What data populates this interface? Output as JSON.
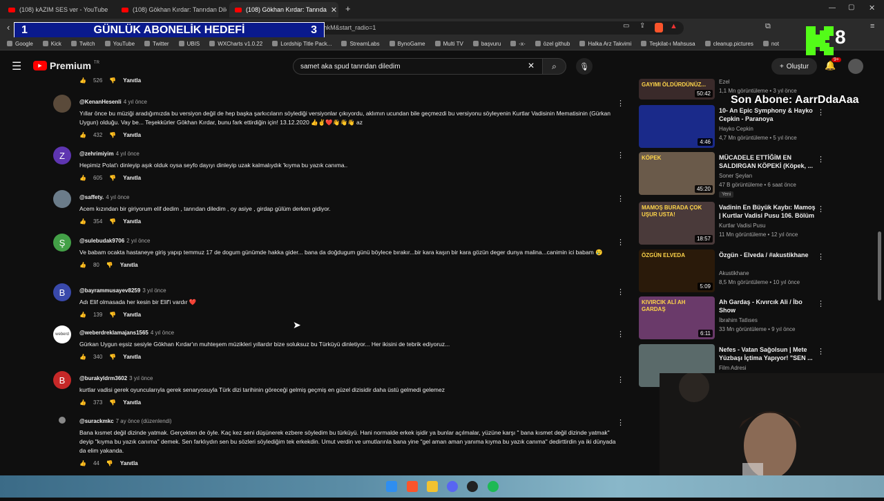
{
  "browser": {
    "tabs": [
      {
        "title": "(108) kAZIM SES ver - YouTube",
        "active": false
      },
      {
        "title": "(108) Gökhan Kırdar: Tanrıdan Diledin",
        "active": false
      },
      {
        "title": "(108) Gökhan Kırdar: Tanrıda",
        "active": true
      }
    ],
    "url": "vatch?v=NjaucnidhkM&list=RDNjaucnidhkM&start_radio=1",
    "bookmarks": [
      "Google",
      "Kick",
      "Twitch",
      "YouTube",
      "Twitter",
      "UBIS",
      "WXCharts v1.0.22",
      "Lordship Title Pack...",
      "StreamLabs",
      "BynoGame",
      "Multi TV",
      "başvuru",
      "-x-",
      "özel github",
      "Halka Arz Takvimi",
      "Teşkilat-ı Mahsusa",
      "cleanup.pictures",
      "not"
    ]
  },
  "overlay": {
    "goal_number": "1",
    "goal_label": "GÜNLÜK ABONELİK HEDEFİ",
    "goal_target": "3",
    "counter": "8",
    "last_sub": "Son Abone: AarrDdaAaa"
  },
  "header": {
    "logo": "Premium",
    "logo_sup": "TR",
    "search_value": "samet aka spud tanrıdan diledim",
    "create_label": "Oluştur",
    "notif_count": "9+"
  },
  "top_partial": {
    "likes": "526",
    "reply": "Yanıtla"
  },
  "comments": [
    {
      "handle": "@KenanHesenli",
      "time": "4 yıl önce",
      "avatar": "img",
      "avatar_color": "#5a4a3a",
      "text": "Yıllar önce bu müziği aradığımızda bu versiyon değil de hep başka şarkıcıların söylediği versiyonlar çıkıyordu, aklımın ucundan bile geçmezdi bu versiyonu söyleyenin Kurtlar Vadisinin Mematisinin (Gürkan Uygun) olduğu. Vay be... Teşekkürler Gökhan Kırdar, bunu fark ettirdiğin için! 13.12.2020 👍✌❤️👋👋👋 az",
      "likes": "432",
      "reply": "Yanıtla"
    },
    {
      "handle": "@zehrimiyim",
      "time": "4 yıl önce",
      "avatar": "Z",
      "avatar_color": "#5e35b1",
      "text": "Hepimiz Polat'ı dinleyip aşık olduk oysa seyfo dayıyı dinleyip uzak kalmalıydık 'kıyma bu yazık canıma..",
      "likes": "605",
      "reply": "Yanıtla"
    },
    {
      "handle": "@saffety.",
      "time": "4 yıl önce",
      "avatar": "img",
      "avatar_color": "#6b7c8a",
      "text": "Acem kızından bir giriyorum elif dedim , tanrıdan diledim , oy asiye , girdap gülüm derken gidiyor.",
      "likes": "354",
      "reply": "Yanıtla"
    },
    {
      "handle": "@sulebudak9706",
      "time": "2 yıl önce",
      "avatar": "Ş",
      "avatar_color": "#43a047",
      "text": "Ve babam ocakta hastaneye giriş yapıp temmuz 17 de dogum günümde hakka gider... bana da doğdugum günü böylece bırakır...bir kara kaşın bir kara gözün deger dunya malina...canimin ici babam 😢",
      "likes": "80",
      "reply": "Yanıtla"
    },
    {
      "handle": "@bayrammusayev8259",
      "time": "3 yıl önce",
      "avatar": "B",
      "avatar_color": "#3949ab",
      "text": "Adı Elif olmasada her kesin bir Elif'i vardır ❤️",
      "likes": "139",
      "reply": "Yanıtla"
    },
    {
      "handle": "@weberdreklamajans1565",
      "time": "4 yıl önce",
      "avatar": "weberd",
      "avatar_color": "#ffffff",
      "text": "Gürkan Uygun eşsiz sesiyle Gökhan Kırdar'ın muhteşem müzikleri yıllardır bize soluksuz bu Türküyü dinletiyor... Her ikisini de tebrik ediyoruz...",
      "likes": "340",
      "reply": "Yanıtla"
    },
    {
      "handle": "@burakyldrm3602",
      "time": "3 yıl önce",
      "avatar": "B",
      "avatar_color": "#c62828",
      "text": "kurtlar vadisi gerek oyuncularıyla gerek senaryosuyla Türk dizi tarihinin göreceği gelmiş geçmiş en güzel dizisidir  daha üstü gelmedi gelemez",
      "likes": "373",
      "reply": "Yanıtla"
    },
    {
      "handle": "@surackmkc",
      "time": "7 ay önce (düzenlendi)",
      "avatar": "img",
      "avatar_color": "#0f0f0f",
      "text": "Bana kısmet değil dizinde yatmak. Gerçekten de öyle. Kaç kez seni düşünerek ezbere söyledim bu türküyü. Hani normalde erkek işidir ya bunlar açılmalar,  yüzüne karşı \" bana kısmet değil dizinde yatmak\" deyip \"kıyma bu yazık canıma\" demek. Sen farklıydın sen bu sözleri söylediğim tek erkekdin. Umut verdin ve umutlarınla bana yine \"gel aman aman yanıma kıyma bu yazık canıma\" dedirttirdin ya iki dünyada da elim yakanda.",
      "likes": "44",
      "reply": "Yanıtla"
    }
  ],
  "recommendations": [
    {
      "title": "",
      "channel": "Ezel",
      "meta": "1,1 Mn görüntüleme • 3 yıl önce",
      "duration": "50:42",
      "thumb_color": "#3a2a2a",
      "thumb_text": "GAYIMI ÖLDÜRDÜNÜZ..."
    },
    {
      "title": "10- An Epic Symphony & Hayko Cepkin - Paranoya",
      "channel": "Hayko Cepkin",
      "meta": "4,7 Mn görüntüleme • 5 yıl önce",
      "duration": "4:46",
      "thumb_color": "#1a2a8a",
      "thumb_text": ""
    },
    {
      "title": "MÜCADELE ETTİĞİM EN SALDIRGAN KÖPEKİ (Köpek, ...",
      "channel": "Soner Şeylan",
      "meta": "47 B görüntüleme • 6 saat önce",
      "duration": "45:20",
      "thumb_color": "#6a5a4a",
      "thumb_text": "KÖPEK",
      "badge": "Yeni"
    },
    {
      "title": "Vadinin En Büyük Kaybı: Mamoş | Kurtlar Vadisi Pusu 106. Bölüm",
      "channel": "Kurtlar Vadisi Pusu",
      "meta": "11 Mn görüntüleme • 12 yıl önce",
      "duration": "18:57",
      "thumb_color": "#4a3a3a",
      "thumb_text": "MAMOŞ BURADA ÇOK UŞUR USTA!"
    },
    {
      "title": "Özgün - Elveda / #akustikhane",
      "channel": "Akustikhane",
      "meta": "8,5 Mn görüntüleme • 10 yıl önce",
      "duration": "5:09",
      "thumb_color": "#2a1a0a",
      "thumb_text": "ÖZGÜN ELVEDA"
    },
    {
      "title": "Ah Gardaş - Kıvırcık Ali / İbo Show",
      "channel": "İbrahim Tatlıses",
      "meta": "33 Mn görüntüleme • 9 yıl önce",
      "duration": "6:11",
      "thumb_color": "#6a3a6a",
      "thumb_text": "KIVIRCIK ALİ AH GARDAŞ"
    },
    {
      "title": "Nefes - Vatan Sağolsun | Mete Yüzbaşı İçtima Yapıyor! \"SEN ...",
      "channel": "Film Adresi",
      "meta": "",
      "duration": "",
      "thumb_color": "#5a6a6a",
      "thumb_text": ""
    }
  ],
  "colors": {
    "accent": "#ff0000",
    "bg": "#0f0f0f"
  }
}
